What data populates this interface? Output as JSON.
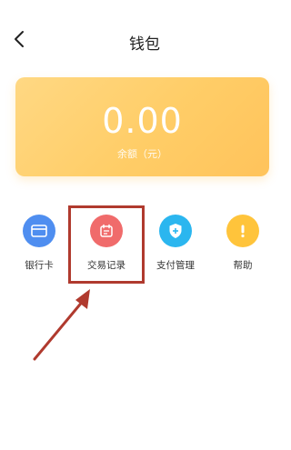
{
  "header": {
    "title": "钱包"
  },
  "balance": {
    "amount": "0.00",
    "label": "余额（元）"
  },
  "menu": [
    {
      "label": "银行卡",
      "color": "#4f8ef0",
      "icon": "card-icon"
    },
    {
      "label": "交易记录",
      "color": "#f06b6b",
      "icon": "record-icon"
    },
    {
      "label": "支付管理",
      "color": "#2bb6ef",
      "icon": "shield-icon"
    },
    {
      "label": "帮助",
      "color": "#ffc43b",
      "icon": "info-icon"
    }
  ],
  "annotation": {
    "color": "#b03a2e"
  }
}
